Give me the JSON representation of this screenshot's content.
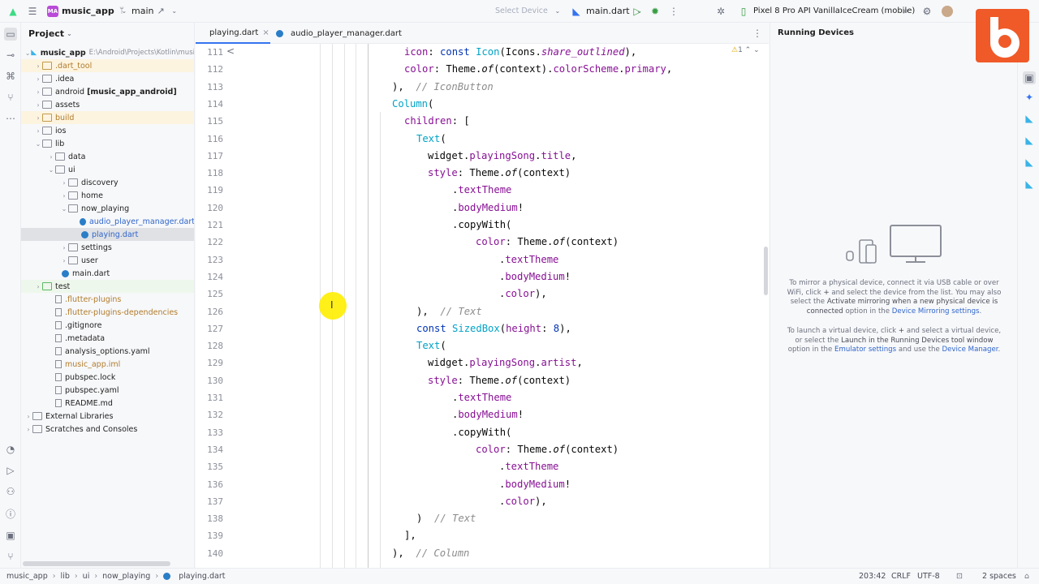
{
  "topbar": {
    "project_badge": "MA",
    "project_name": "music_app",
    "branch": "main",
    "select_device": "Select Device",
    "run_config": "main.dart",
    "device": "Pixel 8 Pro API VanillaIceCream (mobile)"
  },
  "project_panel": {
    "title": "Project",
    "root_name": "music_app",
    "root_path": "E:\\Android\\Projects\\Kotlin\\musi",
    "items": [
      {
        "label": ".dart_tool",
        "color": "#b07b2b"
      },
      {
        "label": ".idea",
        "color": "#1f1f1f"
      },
      {
        "label": "android",
        "extra": "[music_app_android]",
        "color": "#1f1f1f"
      },
      {
        "label": "assets",
        "color": "#1f1f1f"
      },
      {
        "label": "build",
        "color": "#b07b2b"
      },
      {
        "label": "ios",
        "color": "#1f1f1f"
      },
      {
        "label": "lib",
        "color": "#1f1f1f"
      },
      {
        "label": "data",
        "color": "#1f1f1f"
      },
      {
        "label": "ui",
        "color": "#1f1f1f"
      },
      {
        "label": "discovery",
        "color": "#1f1f1f"
      },
      {
        "label": "home",
        "color": "#1f1f1f"
      },
      {
        "label": "now_playing",
        "color": "#1f1f1f"
      },
      {
        "label": "audio_player_manager.dart",
        "color": "#2f65ca"
      },
      {
        "label": "playing.dart",
        "color": "#2f65ca"
      },
      {
        "label": "settings",
        "color": "#1f1f1f"
      },
      {
        "label": "user",
        "color": "#1f1f1f"
      },
      {
        "label": "main.dart",
        "color": "#1f1f1f"
      },
      {
        "label": "test",
        "color": "#1f1f1f"
      },
      {
        "label": ".flutter-plugins",
        "color": "#b07b2b"
      },
      {
        "label": ".flutter-plugins-dependencies",
        "color": "#b07b2b"
      },
      {
        "label": ".gitignore",
        "color": "#1f1f1f"
      },
      {
        "label": ".metadata",
        "color": "#1f1f1f"
      },
      {
        "label": "analysis_options.yaml",
        "color": "#1f1f1f"
      },
      {
        "label": "music_app.iml",
        "color": "#b07b2b"
      },
      {
        "label": "pubspec.lock",
        "color": "#1f1f1f"
      },
      {
        "label": "pubspec.yaml",
        "color": "#1f1f1f"
      },
      {
        "label": "README.md",
        "color": "#1f1f1f"
      },
      {
        "label": "External Libraries",
        "color": "#1f1f1f"
      },
      {
        "label": "Scratches and Consoles",
        "color": "#1f1f1f"
      }
    ]
  },
  "tabs": [
    {
      "label": "playing.dart",
      "close": "×"
    },
    {
      "label": "audio_player_manager.dart"
    }
  ],
  "editor": {
    "warnings": "1",
    "line_numbers": [
      "111",
      "112",
      "113",
      "114",
      "115",
      "116",
      "117",
      "118",
      "119",
      "120",
      "121",
      "122",
      "123",
      "124",
      "125",
      "126",
      "127",
      "128",
      "129",
      "130",
      "131",
      "132",
      "133",
      "134",
      "135",
      "136",
      "137",
      "138",
      "139",
      "140"
    ]
  },
  "running_devices": {
    "title": "Running Devices",
    "p1_a": "To mirror a physical device, connect it via USB cable or over WiFi, click ",
    "p1_b": " and select the device from the list. You may also select the ",
    "p1_c": "Activate mirroring when a new physical device is connected",
    "p1_d": " option in the ",
    "p1_e": "Device Mirroring settings",
    "p1_f": ".",
    "p2_a": "To launch a virtual device, click ",
    "p2_b": " and select a virtual device, or select the ",
    "p2_c": "Launch in the Running Devices tool window",
    "p2_d": " option in the ",
    "p2_e": "Emulator settings",
    "p2_f": " and use the ",
    "p2_g": "Device Manager",
    "p2_h": "."
  },
  "statusbar": {
    "crumbs": [
      "music_app",
      "lib",
      "ui",
      "now_playing",
      "playing.dart"
    ],
    "position": "203:42",
    "line_sep": "CRLF",
    "encoding": "UTF-8",
    "indent": "2 spaces"
  },
  "colors": {
    "accent": "#3574f0",
    "brand_badge": "#f05a28"
  }
}
